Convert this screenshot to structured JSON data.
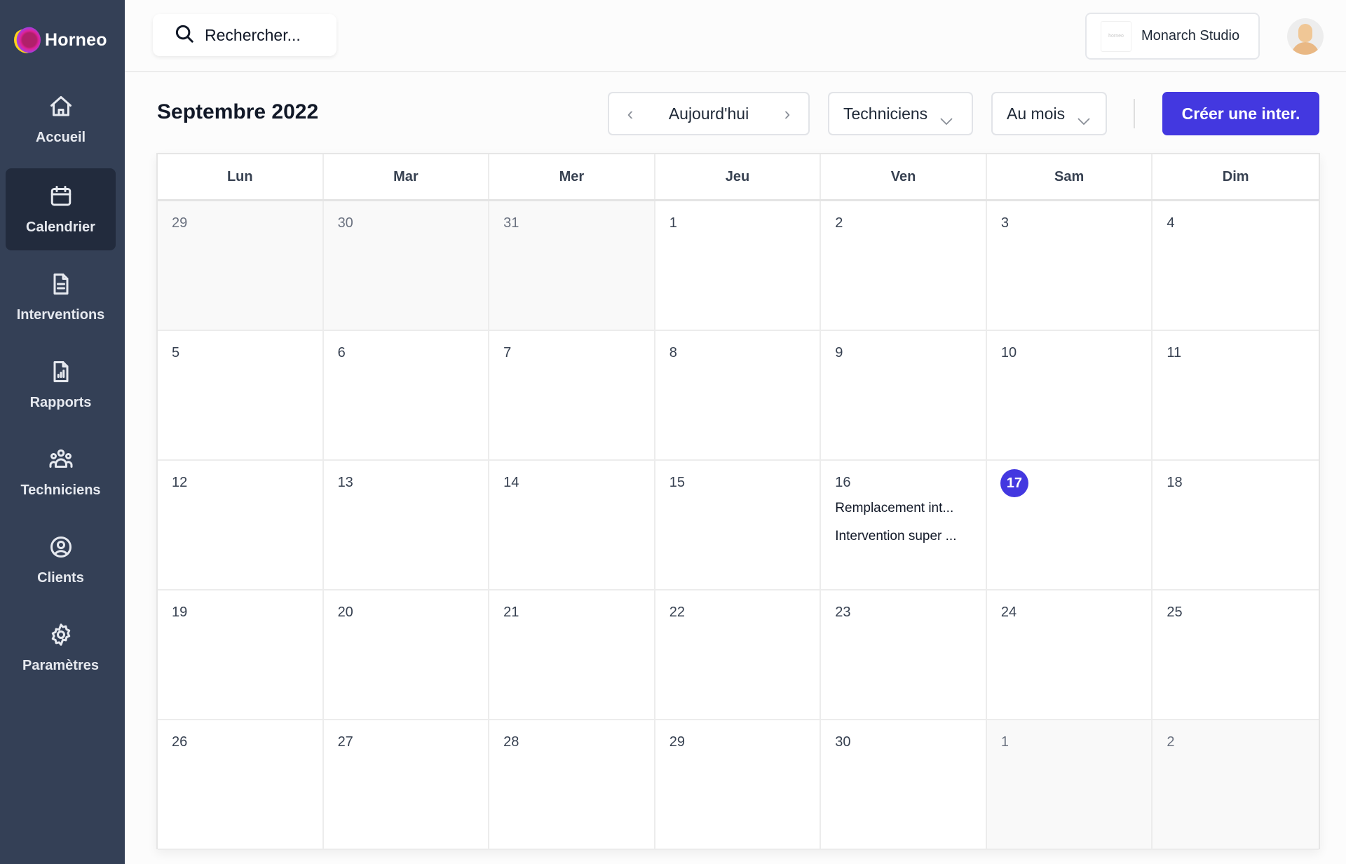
{
  "app": {
    "name": "Horneo",
    "brand_color": "#4338e0",
    "sidebar_color": "#344056"
  },
  "sidebar": {
    "items": [
      {
        "label": "Accueil",
        "icon": "home-icon",
        "active": false
      },
      {
        "label": "Calendrier",
        "icon": "calendar-icon",
        "active": true
      },
      {
        "label": "Interventions",
        "icon": "document-icon",
        "active": false
      },
      {
        "label": "Rapports",
        "icon": "report-chart-icon",
        "active": false
      },
      {
        "label": "Techniciens",
        "icon": "team-icon",
        "active": false
      },
      {
        "label": "Clients",
        "icon": "user-circle-icon",
        "active": false
      },
      {
        "label": "Paramètres",
        "icon": "gear-icon",
        "active": false
      }
    ]
  },
  "topbar": {
    "search_placeholder": "Rechercher...",
    "company_name": "Monarch Studio",
    "company_logo_text": "horneo"
  },
  "toolbar": {
    "title": "Septembre 2022",
    "prev_label": "‹",
    "today_label": "Aujourd'hui",
    "next_label": "›",
    "technicians_filter": "Techniciens",
    "view_select": "Au mois",
    "create_label": "Créer une inter."
  },
  "calendar": {
    "weekdays": [
      "Lun",
      "Mar",
      "Mer",
      "Jeu",
      "Ven",
      "Sam",
      "Dim"
    ],
    "today": 17,
    "weeks": [
      [
        {
          "day": "29",
          "outside": true
        },
        {
          "day": "30",
          "outside": true
        },
        {
          "day": "31",
          "outside": true
        },
        {
          "day": "1"
        },
        {
          "day": "2"
        },
        {
          "day": "3"
        },
        {
          "day": "4"
        }
      ],
      [
        {
          "day": "5"
        },
        {
          "day": "6"
        },
        {
          "day": "7"
        },
        {
          "day": "8"
        },
        {
          "day": "9"
        },
        {
          "day": "10"
        },
        {
          "day": "11"
        }
      ],
      [
        {
          "day": "12"
        },
        {
          "day": "13"
        },
        {
          "day": "14"
        },
        {
          "day": "15"
        },
        {
          "day": "16",
          "events": [
            "Remplacement int...",
            "Intervention super ..."
          ]
        },
        {
          "day": "17",
          "today": true
        },
        {
          "day": "18"
        }
      ],
      [
        {
          "day": "19"
        },
        {
          "day": "20"
        },
        {
          "day": "21"
        },
        {
          "day": "22"
        },
        {
          "day": "23"
        },
        {
          "day": "24"
        },
        {
          "day": "25"
        }
      ],
      [
        {
          "day": "26"
        },
        {
          "day": "27"
        },
        {
          "day": "28"
        },
        {
          "day": "29"
        },
        {
          "day": "30"
        },
        {
          "day": "1",
          "outside": true
        },
        {
          "day": "2",
          "outside": true
        }
      ]
    ]
  }
}
